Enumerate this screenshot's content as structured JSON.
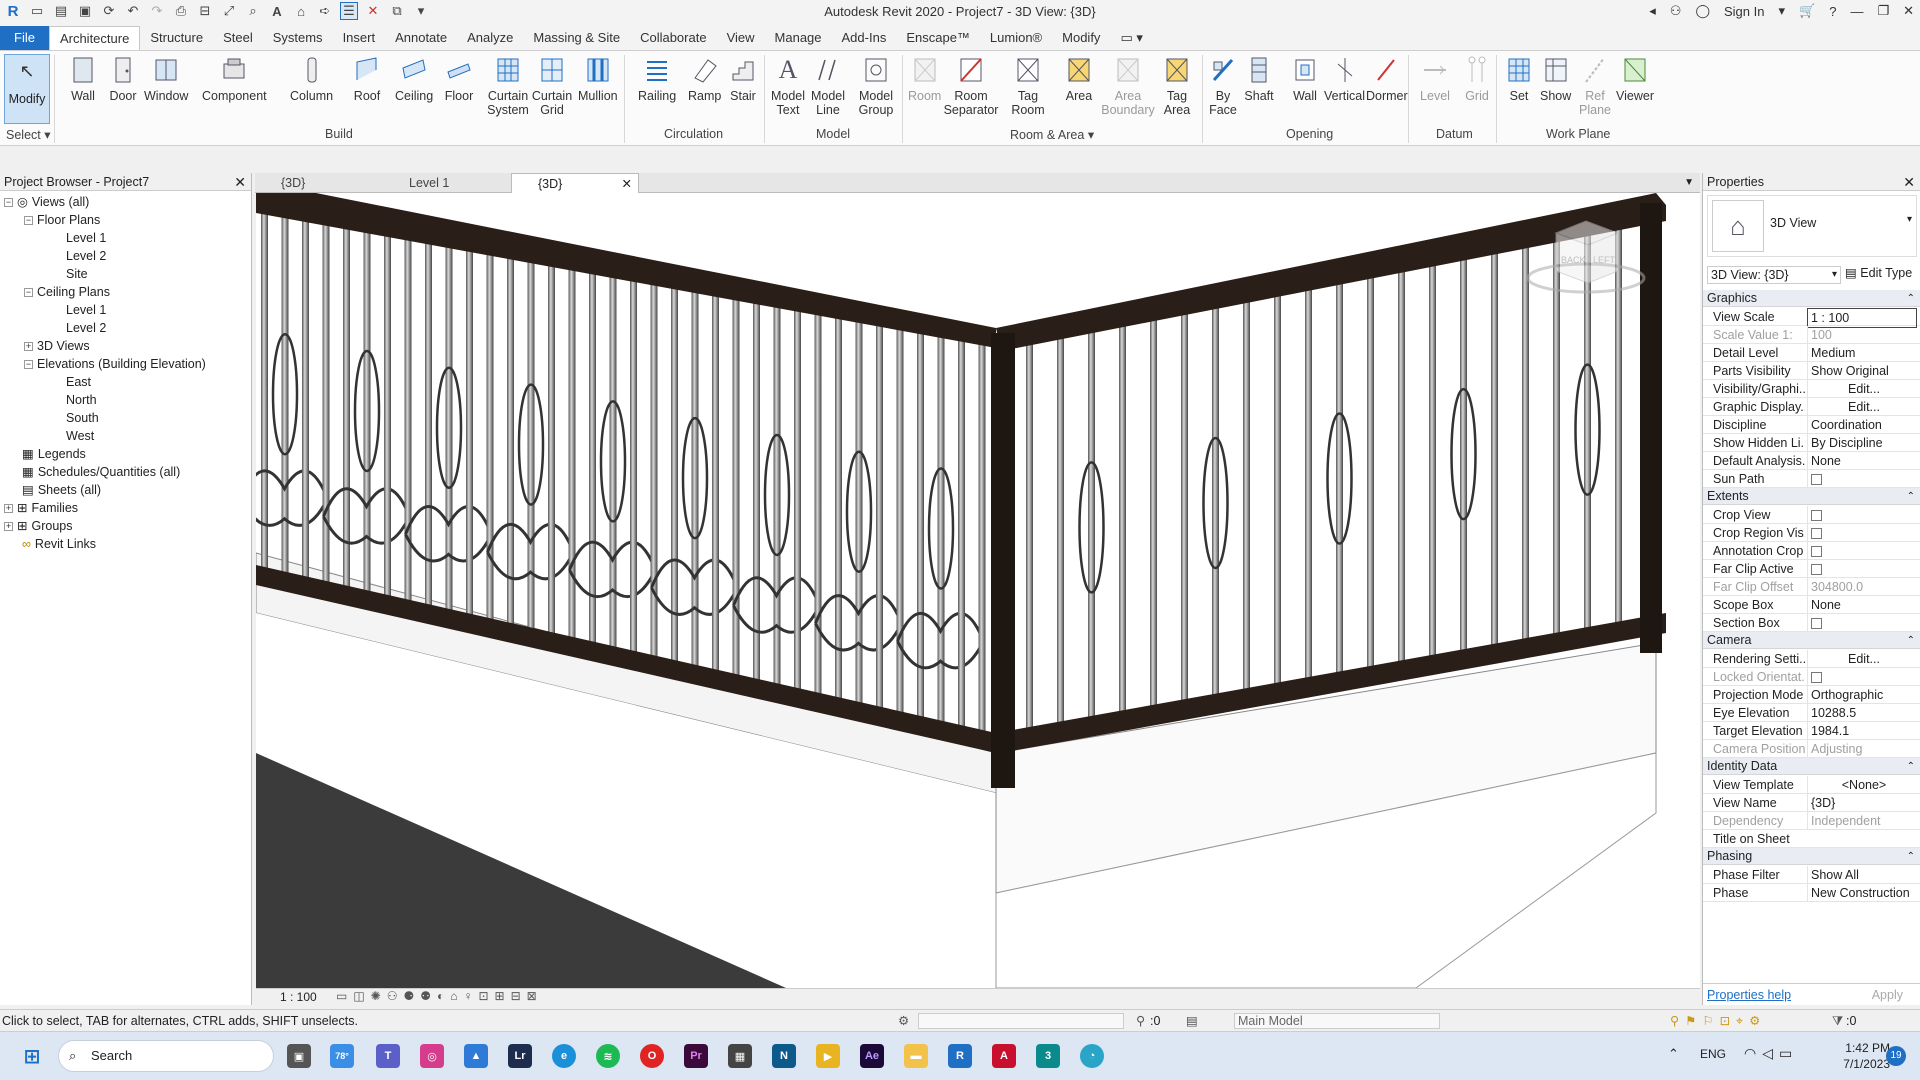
{
  "title_bar": {
    "app_title": "Autodesk Revit 2020 - Project7 - 3D View: {3D}",
    "sign_in": "Sign In"
  },
  "ribbon_tabs": [
    "File",
    "Architecture",
    "Structure",
    "Steel",
    "Systems",
    "Insert",
    "Annotate",
    "Analyze",
    "Massing & Site",
    "Collaborate",
    "View",
    "Manage",
    "Add-Ins",
    "Enscape™",
    "Lumion®",
    "Modify"
  ],
  "ribbon": {
    "modify": "Modify",
    "select": "Select",
    "build": {
      "label": "Build",
      "buttons": [
        "Wall",
        "Door",
        "Window",
        "Component",
        "Column",
        "Roof",
        "Ceiling",
        "Floor",
        "Curtain System",
        "Curtain Grid",
        "Mullion"
      ]
    },
    "circulation": {
      "label": "Circulation",
      "buttons": [
        "Railing",
        "Ramp",
        "Stair"
      ]
    },
    "model": {
      "label": "Model",
      "buttons": [
        "Model Text",
        "Model Line",
        "Model Group"
      ]
    },
    "room_area": {
      "label": "Room & Area",
      "buttons": [
        "Room",
        "Room Separator",
        "Tag Room",
        "Area",
        "Area Boundary",
        "Tag Area"
      ]
    },
    "opening": {
      "label": "Opening",
      "buttons": [
        "By Face",
        "Shaft",
        "Wall",
        "Vertical",
        "Dormer"
      ]
    },
    "datum": {
      "label": "Datum",
      "buttons": [
        "Level",
        "Grid"
      ]
    },
    "work_plane": {
      "label": "Work Plane",
      "buttons": [
        "Set",
        "Show",
        "Ref Plane",
        "Viewer"
      ]
    }
  },
  "project_browser": {
    "title": "Project Browser - Project7",
    "items": [
      "Views (all)",
      "Floor Plans",
      "Level 1",
      "Level 2",
      "Site",
      "Ceiling Plans",
      "Level 1",
      "Level 2",
      "3D Views",
      "Elevations (Building Elevation)",
      "East",
      "North",
      "South",
      "West",
      "Legends",
      "Schedules/Quantities (all)",
      "Sheets (all)",
      "Families",
      "Groups",
      "Revit Links"
    ]
  },
  "view_tabs": [
    "{3D}",
    "Level 1",
    "{3D}"
  ],
  "view_bar": {
    "scale": "1 : 100"
  },
  "properties": {
    "title": "Properties",
    "type_name": "3D View",
    "selector": "3D View: {3D}",
    "edit_type": "Edit Type",
    "groups": [
      {
        "name": "Graphics",
        "rows": [
          [
            "View Scale",
            "1 : 100"
          ],
          [
            "Scale Value 1:",
            "100"
          ],
          [
            "Detail Level",
            "Medium"
          ],
          [
            "Parts Visibility",
            "Show Original"
          ],
          [
            "Visibility/Graphi...",
            "Edit..."
          ],
          [
            "Graphic Display...",
            "Edit..."
          ],
          [
            "Discipline",
            "Coordination"
          ],
          [
            "Show Hidden Li...",
            "By Discipline"
          ],
          [
            "Default Analysis...",
            "None"
          ],
          [
            "Sun Path",
            ""
          ]
        ]
      },
      {
        "name": "Extents",
        "rows": [
          [
            "Crop View",
            ""
          ],
          [
            "Crop Region Vis...",
            ""
          ],
          [
            "Annotation Crop",
            ""
          ],
          [
            "Far Clip Active",
            ""
          ],
          [
            "Far Clip Offset",
            "304800.0"
          ],
          [
            "Scope Box",
            "None"
          ],
          [
            "Section Box",
            ""
          ]
        ]
      },
      {
        "name": "Camera",
        "rows": [
          [
            "Rendering Setti...",
            "Edit..."
          ],
          [
            "Locked Orientat...",
            ""
          ],
          [
            "Projection Mode",
            "Orthographic"
          ],
          [
            "Eye Elevation",
            "10288.5"
          ],
          [
            "Target Elevation",
            "1984.1"
          ],
          [
            "Camera Position",
            "Adjusting"
          ]
        ]
      },
      {
        "name": "Identity Data",
        "rows": [
          [
            "View Template",
            "<None>"
          ],
          [
            "View Name",
            "{3D}"
          ],
          [
            "Dependency",
            "Independent"
          ],
          [
            "Title on Sheet",
            ""
          ]
        ]
      },
      {
        "name": "Phasing",
        "rows": [
          [
            "Phase Filter",
            "Show All"
          ],
          [
            "Phase",
            "New Construction"
          ]
        ]
      }
    ],
    "help": "Properties help",
    "apply": "Apply"
  },
  "status": {
    "hint": "Click to select, TAB for alternates, CTRL adds, SHIFT unselects.",
    "zero1": ":0",
    "model": "Main Model",
    "zero2": ":0"
  },
  "taskbar": {
    "search": "Search",
    "weather": "78°",
    "lang": "ENG",
    "time": "1:42 PM",
    "date": "7/1/2023",
    "badge": "19"
  },
  "viewcube": {
    "back": "BACK",
    "left": "LEFT"
  }
}
